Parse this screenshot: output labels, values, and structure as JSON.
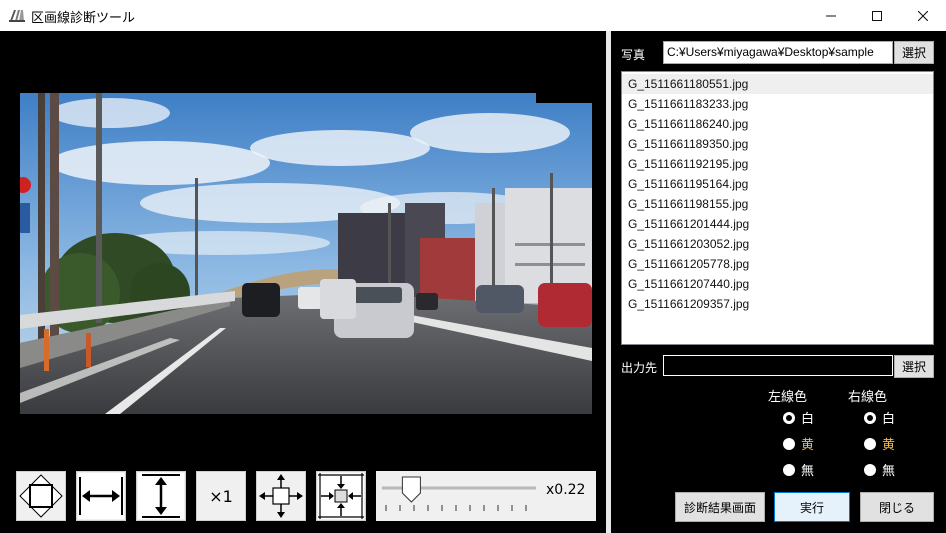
{
  "window": {
    "title": "区画線診断ツール",
    "minimize_glyph": "—",
    "maximize_glyph": "☐",
    "close_glyph": "✕"
  },
  "toolbar": {
    "zoom_1x_label": "×1",
    "zoom_value": "x0.22",
    "slider_level": 0.22
  },
  "photo_section": {
    "label": "写真",
    "path": "C:¥Users¥miyagawa¥Desktop¥sample",
    "browse_label": "選択"
  },
  "files": [
    "G_1511661180551.jpg",
    "G_1511661183233.jpg",
    "G_1511661186240.jpg",
    "G_1511661189350.jpg",
    "G_1511661192195.jpg",
    "G_1511661195164.jpg",
    "G_1511661198155.jpg",
    "G_1511661201444.jpg",
    "G_1511661203052.jpg",
    "G_1511661205778.jpg",
    "G_1511661207440.jpg",
    "G_1511661209357.jpg"
  ],
  "output_section": {
    "label": "出力先",
    "path": "",
    "browse_label": "選択"
  },
  "left_line": {
    "heading": "左線色",
    "options": [
      "白",
      "黄",
      "無"
    ],
    "selected": "白"
  },
  "right_line": {
    "heading": "右線色",
    "options": [
      "白",
      "黄",
      "無"
    ],
    "selected": "白"
  },
  "colors": {
    "yellow_option": "#f5b94a",
    "white_option": "#ffffff"
  },
  "actions": {
    "result_screen_label": "診断結果画面",
    "run_label": "実行",
    "close_label": "閉じる"
  }
}
